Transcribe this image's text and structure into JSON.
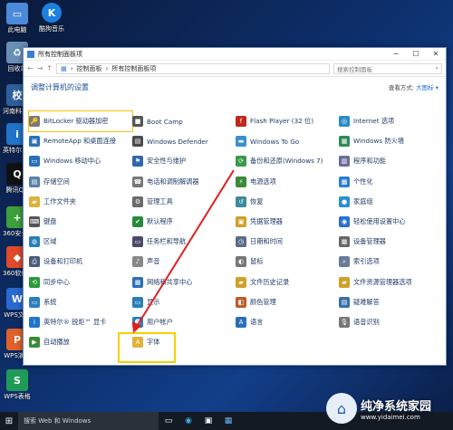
{
  "desktop": {
    "icons": [
      {
        "label": "此电脑",
        "icon": "computer-icon",
        "color": "#4a8ad8",
        "glyph": "▭"
      },
      {
        "label": "回收站",
        "icon": "recycle-bin-icon",
        "color": "#6a8fb5",
        "glyph": "♻"
      },
      {
        "label": "河南科技大学…",
        "icon": "school-icon",
        "color": "#2f5f9a",
        "glyph": "校"
      },
      {
        "label": "英特尔®锐炬™…",
        "icon": "intel-icon",
        "color": "#1f74c7",
        "glyph": "i"
      },
      {
        "label": "腾讯QQ",
        "icon": "qq-icon",
        "color": "#111",
        "glyph": "Q"
      },
      {
        "label": "360安全中心",
        "icon": "360-safe-icon",
        "color": "#3ca03c",
        "glyph": "+"
      },
      {
        "label": "360软件管家",
        "icon": "360-store-icon",
        "color": "#e04a2a",
        "glyph": "◆"
      },
      {
        "label": "WPS文字",
        "icon": "wps-writer-icon",
        "color": "#2a69d0",
        "glyph": "W"
      },
      {
        "label": "WPS演示",
        "icon": "wps-present-icon",
        "color": "#e0612a",
        "glyph": "P"
      },
      {
        "label": "WPS表格",
        "icon": "wps-sheet-icon",
        "color": "#1f9b57",
        "glyph": "S"
      }
    ],
    "kugou": {
      "label": "酷狗音乐",
      "icon": "kugou-icon",
      "color": "#1d7fe0",
      "glyph": "K"
    }
  },
  "window": {
    "title": "所有控制面板项",
    "breadcrumb": [
      "控制面板",
      "所有控制面板项"
    ],
    "search_placeholder": "搜索控制面板",
    "heading": "调整计算机的设置",
    "view_by_label": "查看方式:",
    "view_by_value": "大图标 ▾",
    "items": [
      {
        "label": "BitLocker 驱动器加密",
        "icon": "bitlocker-icon",
        "color": "#7a7a7a",
        "glyph": "🔑"
      },
      {
        "label": "Boot Camp",
        "icon": "bootcamp-icon",
        "color": "#555",
        "glyph": "■"
      },
      {
        "label": "Flash Player (32 位)",
        "icon": "flash-icon",
        "color": "#c0271d",
        "glyph": "f"
      },
      {
        "label": "Internet 选项",
        "icon": "internet-options-icon",
        "color": "#2a8bc8",
        "glyph": "◎"
      },
      {
        "label": "RemoteApp 和桌面连接",
        "icon": "remoteapp-icon",
        "color": "#2a6fb8",
        "glyph": "▣"
      },
      {
        "label": "Windows Defender",
        "icon": "defender-icon",
        "color": "#4a4a4a",
        "glyph": "▤"
      },
      {
        "label": "Windows To Go",
        "icon": "windows-to-go-icon",
        "color": "#3a8fd0",
        "glyph": "▬"
      },
      {
        "label": "Windows 防火墙",
        "icon": "firewall-icon",
        "color": "#2e8b57",
        "glyph": "▦"
      },
      {
        "label": "Windows 移动中心",
        "icon": "mobility-center-icon",
        "color": "#2a6fb8",
        "glyph": "▭"
      },
      {
        "label": "安全性与维护",
        "icon": "security-maintenance-icon",
        "color": "#2f66b0",
        "glyph": "⚑"
      },
      {
        "label": "备份和还原(Windows 7)",
        "icon": "backup-restore-icon",
        "color": "#3a9a4a",
        "glyph": "⟳"
      },
      {
        "label": "程序和功能",
        "icon": "programs-features-icon",
        "color": "#6a6a9a",
        "glyph": "▥"
      },
      {
        "label": "存储空间",
        "icon": "storage-spaces-icon",
        "color": "#5a7fa8",
        "glyph": "▤"
      },
      {
        "label": "电话和调制解调器",
        "icon": "phone-modem-icon",
        "color": "#777",
        "glyph": "☎"
      },
      {
        "label": "电源选项",
        "icon": "power-options-icon",
        "color": "#3a8a3a",
        "glyph": "⚡"
      },
      {
        "label": "个性化",
        "icon": "personalization-icon",
        "color": "#2a7fd0",
        "glyph": "▩"
      },
      {
        "label": "工作文件夹",
        "icon": "work-folders-icon",
        "color": "#e0b23a",
        "glyph": "▰"
      },
      {
        "label": "管理工具",
        "icon": "admin-tools-icon",
        "color": "#6a6a6a",
        "glyph": "⚙"
      },
      {
        "label": "恢复",
        "icon": "recovery-icon",
        "color": "#3a8a9a",
        "glyph": "↺"
      },
      {
        "label": "家庭组",
        "icon": "homegroup-icon",
        "color": "#2a8fd0",
        "glyph": "●"
      },
      {
        "label": "键盘",
        "icon": "keyboard-icon",
        "color": "#555",
        "glyph": "⌨"
      },
      {
        "label": "默认程序",
        "icon": "default-programs-icon",
        "color": "#2a8a3a",
        "glyph": "✔"
      },
      {
        "label": "凭据管理器",
        "icon": "credential-manager-icon",
        "color": "#d0a02a",
        "glyph": "▣"
      },
      {
        "label": "轻松使用设置中心",
        "icon": "ease-of-access-icon",
        "color": "#2a6fd0",
        "glyph": "◉"
      },
      {
        "label": "区域",
        "icon": "region-icon",
        "color": "#2a7fb8",
        "glyph": "◍"
      },
      {
        "label": "任务栏和导航",
        "icon": "taskbar-nav-icon",
        "color": "#4a4a6a",
        "glyph": "▭"
      },
      {
        "label": "日期和时间",
        "icon": "date-time-icon",
        "color": "#5a6a8a",
        "glyph": "◷"
      },
      {
        "label": "设备管理器",
        "icon": "device-manager-icon",
        "color": "#666",
        "glyph": "▦"
      },
      {
        "label": "设备和打印机",
        "icon": "devices-printers-icon",
        "color": "#4a5a7a",
        "glyph": "⎙"
      },
      {
        "label": "声音",
        "icon": "sound-icon",
        "color": "#888",
        "glyph": "♪"
      },
      {
        "label": "鼠标",
        "icon": "mouse-icon",
        "color": "#777",
        "glyph": "◐"
      },
      {
        "label": "索引选项",
        "icon": "indexing-icon",
        "color": "#6a7a9a",
        "glyph": "⌕"
      },
      {
        "label": "同步中心",
        "icon": "sync-center-icon",
        "color": "#2a9a3a",
        "glyph": "⟲"
      },
      {
        "label": "网络和共享中心",
        "icon": "network-sharing-icon",
        "color": "#2a6fb8",
        "glyph": "▦"
      },
      {
        "label": "文件历史记录",
        "icon": "file-history-icon",
        "color": "#d0a02a",
        "glyph": "▰"
      },
      {
        "label": "文件资源管理器选项",
        "icon": "explorer-options-icon",
        "color": "#d0a02a",
        "glyph": "▰"
      },
      {
        "label": "系统",
        "icon": "system-icon",
        "color": "#2a7fb8",
        "glyph": "▭"
      },
      {
        "label": "显示",
        "icon": "display-icon",
        "color": "#2a7fb8",
        "glyph": "▭"
      },
      {
        "label": "颜色管理",
        "icon": "color-management-icon",
        "color": "#c05a2a",
        "glyph": "◧"
      },
      {
        "label": "疑难解答",
        "icon": "troubleshooting-icon",
        "color": "#3a6fa8",
        "glyph": "▤"
      },
      {
        "label": "英特尔® 锐炬™ 显卡",
        "icon": "intel-graphics-icon",
        "color": "#1f74c7",
        "glyph": "i"
      },
      {
        "label": "用户帐户",
        "icon": "user-accounts-icon",
        "color": "#2a7fb8",
        "glyph": "☻"
      },
      {
        "label": "语言",
        "icon": "language-icon",
        "color": "#2a6fb8",
        "glyph": "A"
      },
      {
        "label": "语音识别",
        "icon": "speech-recognition-icon",
        "color": "#777",
        "glyph": "🎙"
      },
      {
        "label": "自动播放",
        "icon": "autoplay-icon",
        "color": "#3a8a3a",
        "glyph": "▶"
      },
      {
        "label": "字体",
        "icon": "fonts-icon",
        "color": "#e0b23a",
        "glyph": "A"
      }
    ]
  },
  "taskbar": {
    "search_text": "搜索 Web 和 Windows"
  },
  "watermark": {
    "title": "纯净系统家园",
    "url": "www.yidaimei.com"
  }
}
